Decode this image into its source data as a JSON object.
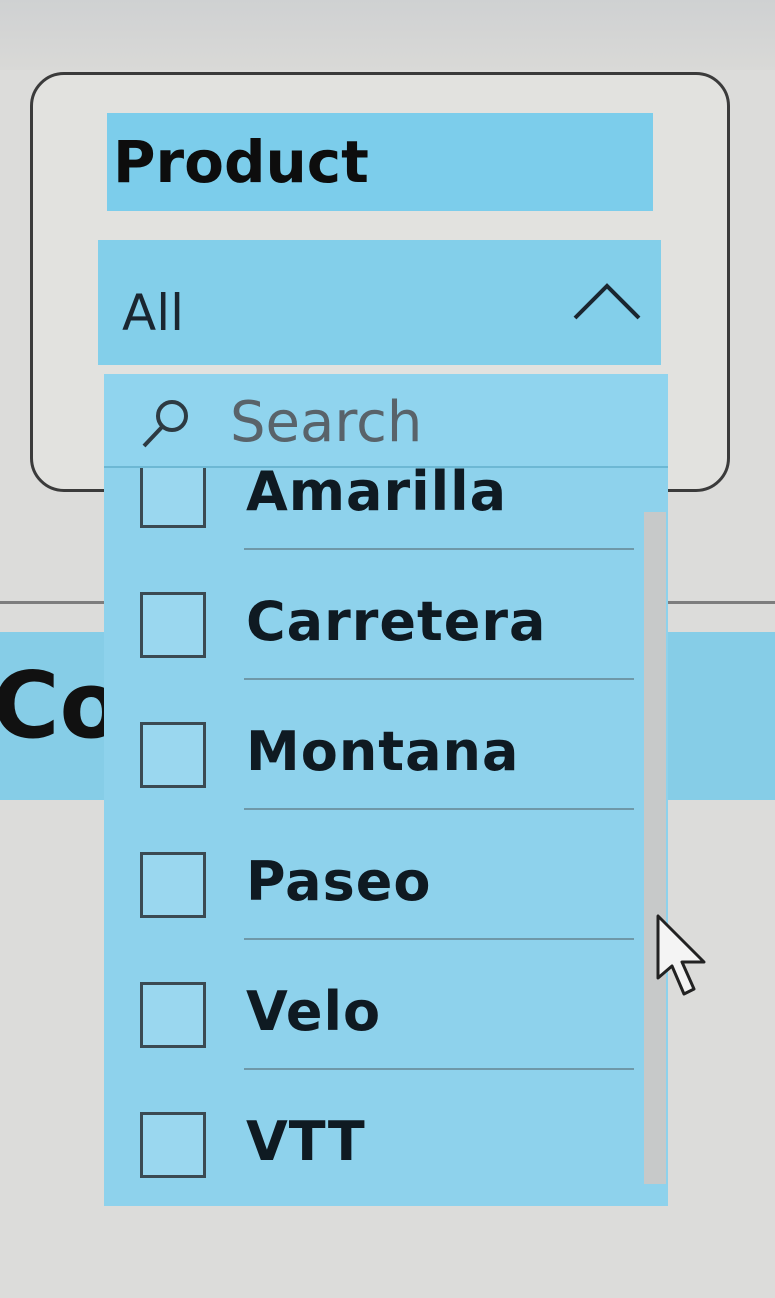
{
  "slicer": {
    "title": "Product",
    "selected_value": "All",
    "search": {
      "placeholder": "Search"
    },
    "items": [
      {
        "label": "Amarilla",
        "checked": false
      },
      {
        "label": "Carretera",
        "checked": false
      },
      {
        "label": "Montana",
        "checked": false
      },
      {
        "label": "Paseo",
        "checked": false
      },
      {
        "label": "Velo",
        "checked": false
      },
      {
        "label": "VTT",
        "checked": false
      }
    ]
  },
  "background": {
    "partial_text": "Co"
  },
  "icons": {
    "expand": "chevron-up-icon",
    "search": "search-icon",
    "cursor": "cursor-icon"
  },
  "colors": {
    "accent": "#7ccdeb",
    "dropdown": "#8ed2ec",
    "card_border": "#3b3b3b"
  }
}
